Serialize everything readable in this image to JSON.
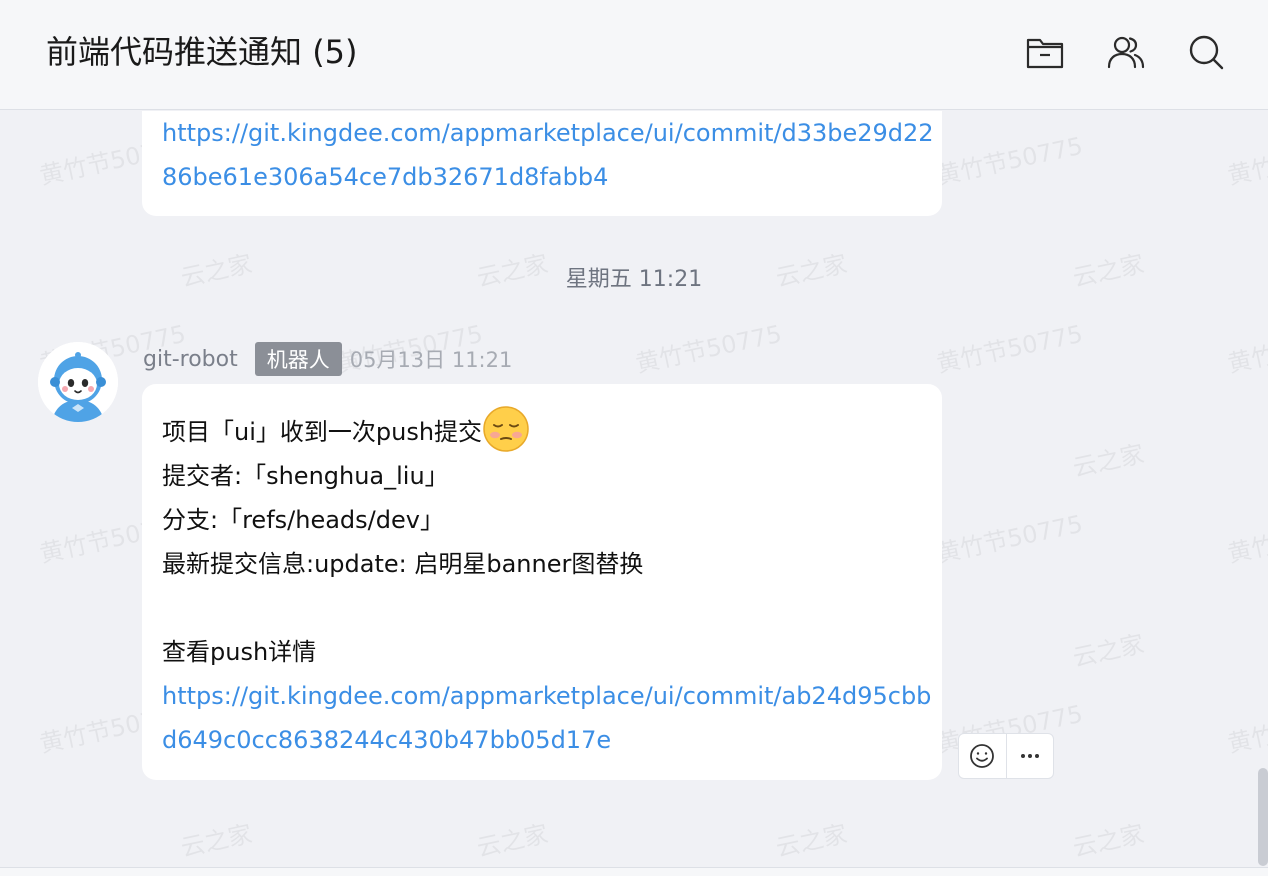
{
  "header": {
    "title": "前端代码推送通知",
    "member_count": "(5)",
    "icons": [
      "folder-icon",
      "members-icon",
      "search-icon"
    ]
  },
  "watermarks": {
    "name_text": "黄竹节50775",
    "brand_text": "云之家"
  },
  "previous_message": {
    "link_line1": "https://git.kingdee.com/appmarketplace/ui/commit/d33be29d22",
    "link_line2": "86be61e306a54ce7db32671d8fabb4"
  },
  "timestamp": "星期五 11:21",
  "message": {
    "sender": "git-robot",
    "badge": "机器人",
    "time": "05月13日 11:21",
    "line1": "项目「ui」收到一次push提交",
    "line1_emoji": "shy-smile-emoji",
    "line2": "提交者:「shenghua_liu」",
    "line3": "分支:「refs/heads/dev」",
    "line4": "最新提交信息:update: 启明星banner图替换",
    "line5": "查看push详情",
    "link_line1": "https://git.kingdee.com/appmarketplace/ui/commit/ab24d95cbb",
    "link_line2": "d649c0cc8638244c430b47bb05d17e"
  },
  "message_actions": {
    "icons": [
      "emoji-reaction-icon",
      "more-icon"
    ]
  },
  "colors": {
    "link": "#3b8ee5",
    "background": "#f0f1f5",
    "badge": "#8b8f97"
  }
}
